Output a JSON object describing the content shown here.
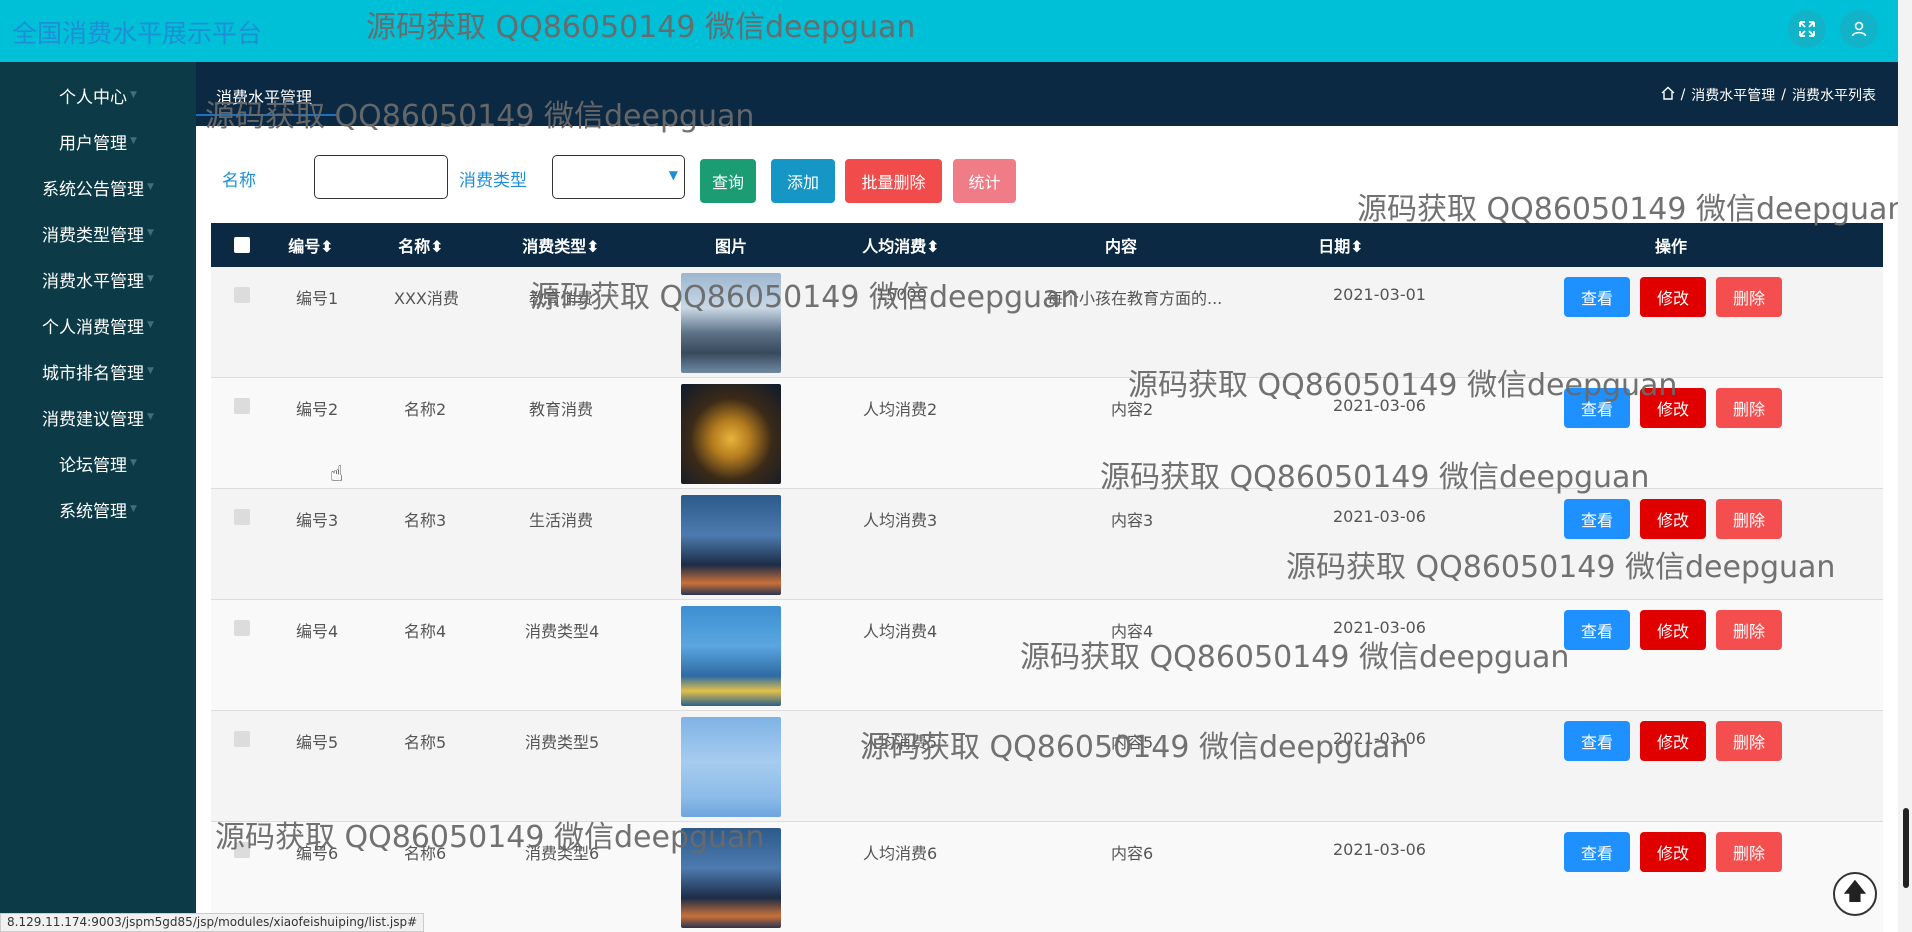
{
  "app": {
    "title": "全国消费水平展示平台"
  },
  "header": {
    "fullscreen_icon": "expand-icon",
    "user_icon": "user-icon"
  },
  "sidebar": {
    "items": [
      {
        "label": "个人中心"
      },
      {
        "label": "用户管理"
      },
      {
        "label": "系统公告管理"
      },
      {
        "label": "消费类型管理"
      },
      {
        "label": "消费水平管理"
      },
      {
        "label": "个人消费管理"
      },
      {
        "label": "城市排名管理"
      },
      {
        "label": "消费建议管理"
      },
      {
        "label": "论坛管理"
      },
      {
        "label": "系统管理"
      }
    ]
  },
  "page": {
    "title": "消费水平管理",
    "breadcrumb": {
      "sep": "/",
      "level1": "消费水平管理",
      "level2": "消费水平列表"
    }
  },
  "search": {
    "name_label": "名称",
    "name_value": "",
    "type_label": "消费类型",
    "type_value": "",
    "query_btn": "查询",
    "add_btn": "添加",
    "batch_delete_btn": "批量删除",
    "stats_btn": "统计"
  },
  "table": {
    "headers": {
      "id": "编号",
      "name": "名称",
      "type": "消费类型",
      "image": "图片",
      "avg": "人均消费",
      "content": "内容",
      "date": "日期",
      "ops": "操作"
    },
    "sort_glyph": "⬍",
    "rows": [
      {
        "id": "编号1",
        "name": "XXX消费",
        "type": "教育消费",
        "avg": "15000",
        "content": "每个小孩在教育方面的...",
        "date": "2021-03-01"
      },
      {
        "id": "编号2",
        "name": "名称2",
        "type": "教育消费",
        "avg": "人均消费2",
        "content": "内容2",
        "date": "2021-03-06"
      },
      {
        "id": "编号3",
        "name": "名称3",
        "type": "生活消费",
        "avg": "人均消费3",
        "content": "内容3",
        "date": "2021-03-06"
      },
      {
        "id": "编号4",
        "name": "名称4",
        "type": "消费类型4",
        "avg": "人均消费4",
        "content": "内容4",
        "date": "2021-03-06"
      },
      {
        "id": "编号5",
        "name": "名称5",
        "type": "消费类型5",
        "avg": "人均消费5",
        "content": "内容5",
        "date": "2021-03-06"
      },
      {
        "id": "编号6",
        "name": "名称6",
        "type": "消费类型6",
        "avg": "人均消费6",
        "content": "内容6",
        "date": "2021-03-06"
      }
    ],
    "actions": {
      "view": "查看",
      "edit": "修改",
      "delete": "删除"
    }
  },
  "colors": {
    "topbar": "#00c0d8",
    "sidebar": "#0c3a47",
    "header_dark": "#0b2942",
    "btn_query": "#1c9c72",
    "btn_add": "#1596c4",
    "btn_delete": "#f24b4b",
    "btn_stats": "#f07c88",
    "btn_view": "#1e90ff",
    "btn_edit": "#e00000",
    "btn_del": "#f44e4e"
  },
  "statusbar": {
    "url": "8.129.11.174:9003/jspm5gd85/jsp/modules/xiaofeishuiping/list.jsp#"
  },
  "watermark": {
    "text": "源码获取 QQ86050149 微信deepguan"
  }
}
